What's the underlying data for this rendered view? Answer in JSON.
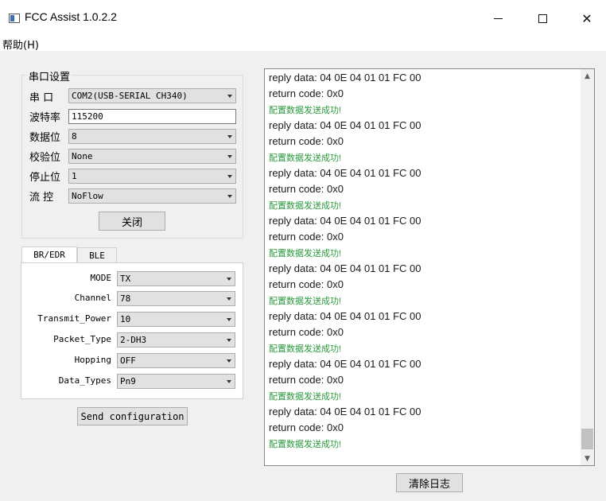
{
  "window": {
    "title": "FCC Assist 1.0.2.2"
  },
  "menu": {
    "help": "帮助(H)"
  },
  "serial": {
    "group_title": "串口设置",
    "port_label": "串 口",
    "port_value": "COM2(USB-SERIAL CH340)",
    "baud_label": "波特率",
    "baud_value": "115200",
    "databits_label": "数据位",
    "databits_value": "8",
    "parity_label": "校验位",
    "parity_value": "None",
    "stopbits_label": "停止位",
    "stopbits_value": "1",
    "flow_label": "流 控",
    "flow_value": "NoFlow",
    "close_button": "关闭"
  },
  "tabs": [
    "BR/EDR",
    "BLE"
  ],
  "config": {
    "fields": [
      {
        "label": "MODE",
        "value": "TX"
      },
      {
        "label": "Channel",
        "value": "78"
      },
      {
        "label": "Transmit_Power",
        "value": "10"
      },
      {
        "label": "Packet_Type",
        "value": "2-DH3"
      },
      {
        "label": "Hopping",
        "value": "OFF"
      },
      {
        "label": "Data_Types",
        "value": "Pn9"
      }
    ],
    "send_button": "Send configuration"
  },
  "log": {
    "entries": [
      {
        "text": "reply data: 04 0E 04 01 01 FC 00",
        "kind": "reply"
      },
      {
        "text": "return code: 0x0",
        "kind": "ret"
      },
      {
        "text": "配置数据发送成功!",
        "kind": "ok"
      },
      {
        "text": "reply data: 04 0E 04 01 01 FC 00",
        "kind": "reply"
      },
      {
        "text": "return code: 0x0",
        "kind": "ret"
      },
      {
        "text": "配置数据发送成功!",
        "kind": "ok"
      },
      {
        "text": "reply data: 04 0E 04 01 01 FC 00",
        "kind": "reply"
      },
      {
        "text": "return code: 0x0",
        "kind": "ret"
      },
      {
        "text": "配置数据发送成功!",
        "kind": "ok"
      },
      {
        "text": "reply data: 04 0E 04 01 01 FC 00",
        "kind": "reply"
      },
      {
        "text": "return code: 0x0",
        "kind": "ret"
      },
      {
        "text": "配置数据发送成功!",
        "kind": "ok"
      },
      {
        "text": "reply data: 04 0E 04 01 01 FC 00",
        "kind": "reply"
      },
      {
        "text": "return code: 0x0",
        "kind": "ret"
      },
      {
        "text": "配置数据发送成功!",
        "kind": "ok"
      },
      {
        "text": "reply data: 04 0E 04 01 01 FC 00",
        "kind": "reply"
      },
      {
        "text": "return code: 0x0",
        "kind": "ret"
      },
      {
        "text": "配置数据发送成功!",
        "kind": "ok"
      },
      {
        "text": "reply data: 04 0E 04 01 01 FC 00",
        "kind": "reply"
      },
      {
        "text": "return code: 0x0",
        "kind": "ret"
      },
      {
        "text": "配置数据发送成功!",
        "kind": "ok"
      },
      {
        "text": "reply data: 04 0E 04 01 01 FC 00",
        "kind": "reply"
      },
      {
        "text": "return code: 0x0",
        "kind": "ret"
      },
      {
        "text": "配置数据发送成功!",
        "kind": "ok"
      }
    ],
    "clear_button": "清除日志"
  },
  "colors": {
    "success": "#2a9a3c"
  }
}
